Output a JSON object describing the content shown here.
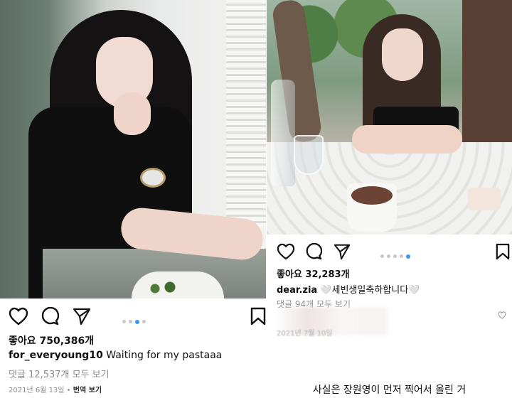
{
  "left_post": {
    "likes": "좋아요 750,386개",
    "username": "for_everyoung10",
    "caption": "Waiting for my pastaaa",
    "comments_link": "댓글 12,537개 모두 보기",
    "date": "2021년 6월 13일",
    "separator": " • ",
    "translate_label": "번역 보기",
    "carousel_total": 4,
    "carousel_active": 3
  },
  "right_post": {
    "likes": "좋아요 32,283개",
    "username": "dear.zia",
    "caption": "🤍세빈생일축하합니다🤍",
    "comments_link": "댓글 94개 모두 보기",
    "date": "2021년 7월 10일",
    "carousel_total": 5,
    "carousel_active": 5
  },
  "bottom_note": "사실은 장원영이 먼저 찍어서 올린 거",
  "icons": {
    "like": "heart-icon",
    "comment": "comment-icon",
    "share": "send-icon",
    "save": "bookmark-icon"
  },
  "colors": {
    "accent": "#3897f0",
    "muted": "#8e8e8e",
    "text": "#111111"
  }
}
